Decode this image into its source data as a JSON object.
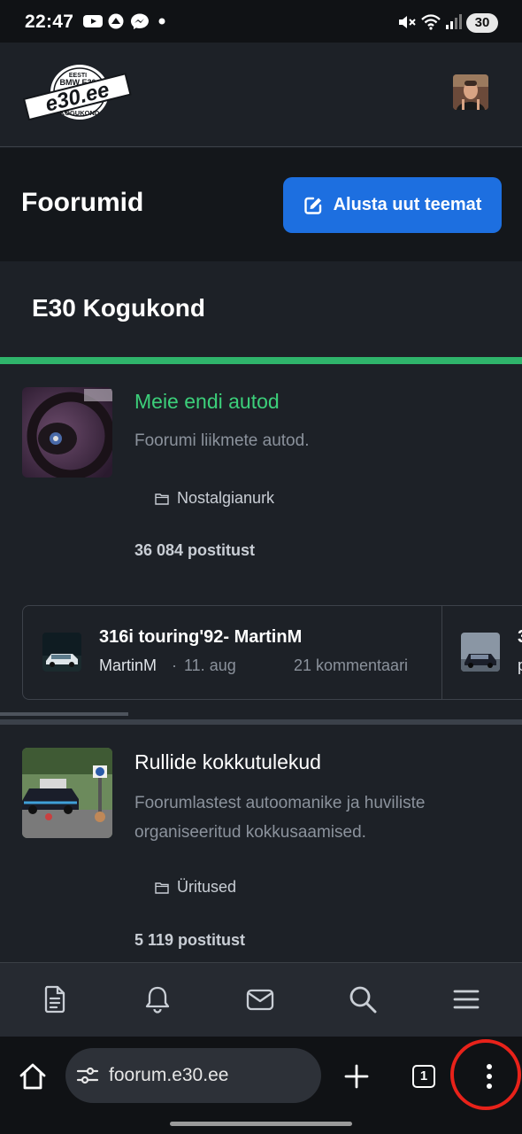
{
  "status_bar": {
    "time": "22:47",
    "battery": "30"
  },
  "header": {
    "logo": {
      "top": "EESTI",
      "middle": "BMW E30",
      "main": "e30.ee",
      "bottom": "KOGUKOND"
    }
  },
  "page": {
    "title": "Foorumid",
    "new_topic_label": "Alusta uut teemat"
  },
  "section": {
    "title": "E30 Kogukond",
    "accent_color": "#2fb46b"
  },
  "forums": [
    {
      "name": "Meie endi autod",
      "name_color": "#3ccf7a",
      "description": "Foorumi liikmete autod.",
      "category": "Nostalgianurk",
      "posts": "36 084 postitust"
    },
    {
      "name": "Rullide kokkutulekud",
      "name_color": "#ffffff",
      "description_line1": "Foorumlastest autoomanike ja huviliste",
      "description_line2": "organiseeritud kokkusaamised.",
      "category": "Üritused",
      "posts": "5 119 postitust"
    }
  ],
  "latest_topics": [
    {
      "title": "316i touring'92- MartinM",
      "author": "MartinM",
      "separator": "·",
      "date": "11. aug",
      "comments": "21 kommentaari"
    },
    {
      "title": "3",
      "author": "p"
    }
  ],
  "bottom_nav": {
    "icons": [
      "document-icon",
      "bell-icon",
      "mail-icon",
      "search-icon",
      "menu-icon"
    ]
  },
  "browser": {
    "url": "foorum.e30.ee",
    "tab_count": "1"
  },
  "colors": {
    "primary_button": "#1d6fe0",
    "highlight_circle": "#e8221a"
  }
}
